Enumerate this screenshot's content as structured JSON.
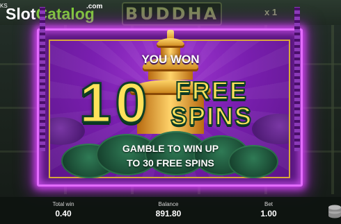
{
  "header": {
    "game_title": "BUDDHA",
    "multiplier": "x 1",
    "watermark_prefix": "KS",
    "watermark_slot": "Slot",
    "watermark_catalog": "Catalog",
    "watermark_tld": ".com"
  },
  "win_popup": {
    "heading": "YOU WON",
    "spin_count": "10",
    "free_label": "FREE",
    "spins_label": "SPINS",
    "gamble_line_1": "GAMBLE TO WIN UP",
    "gamble_line_2": "TO 30 FREE SPINS"
  },
  "footer": {
    "total_win_label": "Total win",
    "total_win_value": "0.40",
    "balance_label": "Balance",
    "balance_value": "891.80",
    "bet_label": "Bet",
    "bet_value": "1.00"
  },
  "icons": {
    "coins": "coins-stack-icon"
  },
  "colors": {
    "frame_glow": "#e36cff",
    "popup_bg": "#7a1fb0",
    "number_gold": "#ffe25a",
    "logo_green": "#7ecf35"
  }
}
